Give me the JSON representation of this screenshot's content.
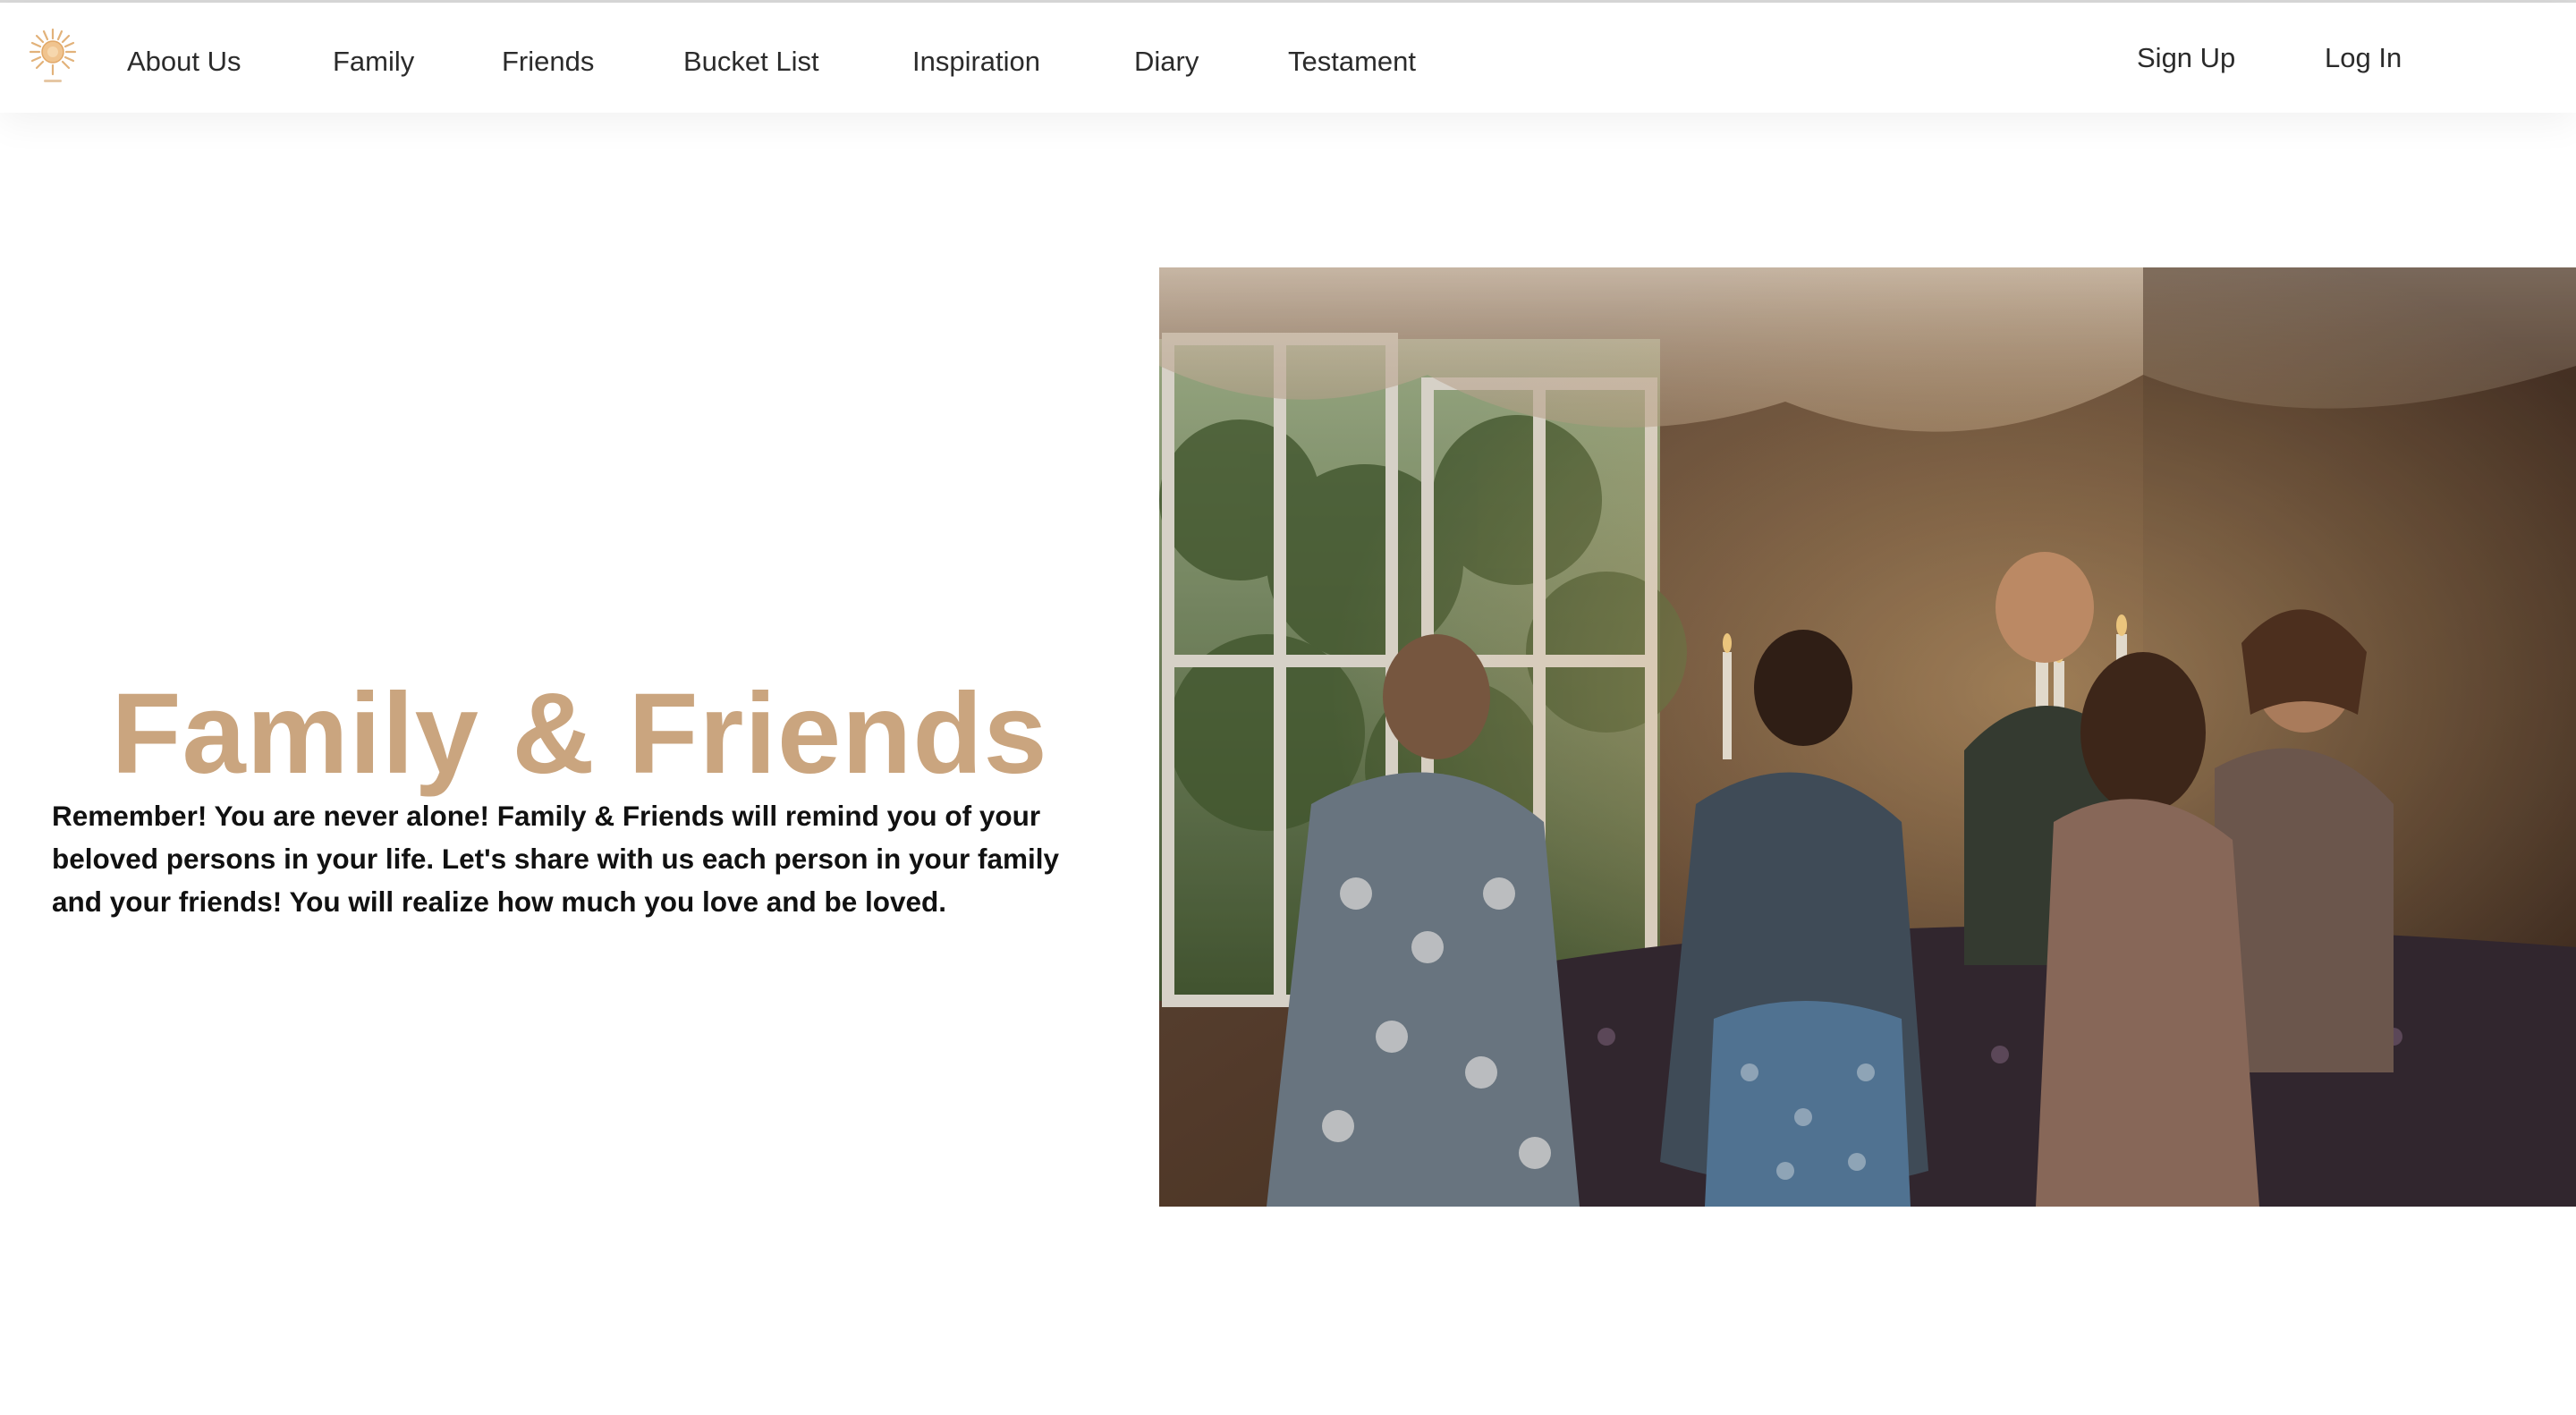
{
  "nav": {
    "logo_icon": "sun-logo-icon",
    "links": [
      "About Us",
      "Family",
      "Friends",
      "Bucket List",
      "Inspiration",
      "Diary",
      "Testament"
    ],
    "sign_up": "Sign Up",
    "log_in": "Log In"
  },
  "hero": {
    "title": "Family & Friends",
    "body": "Remember! You are never alone! Family & Friends will remind you of your beloved persons in your life. Let's share with us each person in your family and your friends! You will realize how much you love and be loved."
  },
  "colors": {
    "accent": "#caa57f",
    "text": "#111111",
    "nav_text": "#2b2b2b"
  }
}
